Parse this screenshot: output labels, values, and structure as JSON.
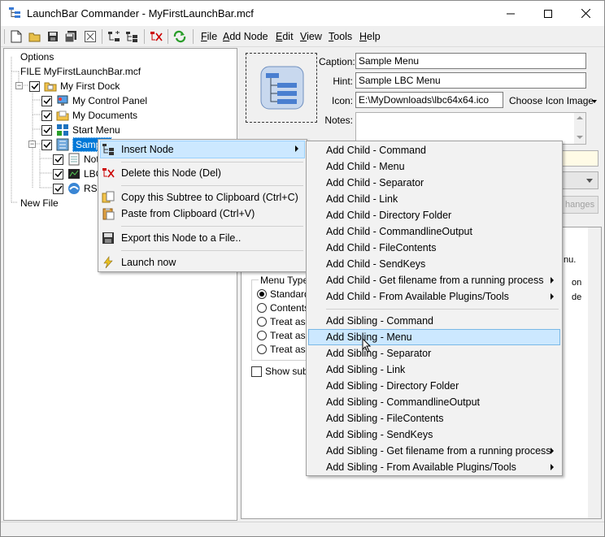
{
  "window": {
    "title": "LaunchBar Commander - MyFirstLaunchBar.mcf",
    "minimize_glyph": "—",
    "maximize_glyph": "☐",
    "close_glyph": "✕"
  },
  "menubar": {
    "items": [
      {
        "label": "File",
        "underline": "F",
        "rest": "ile"
      },
      {
        "label": "Add Node",
        "underline": "A",
        "rest": "dd Node"
      },
      {
        "label": "Edit",
        "underline": "E",
        "rest": "dit"
      },
      {
        "label": "View",
        "underline": "V",
        "rest": "iew"
      },
      {
        "label": "Tools",
        "underline": "T",
        "rest": "ools"
      },
      {
        "label": "Help",
        "underline": "H",
        "rest": "elp"
      }
    ]
  },
  "tree": {
    "options": "Options",
    "file": "FILE MyFirstLaunchBar.mcf",
    "dock": "My First Dock",
    "control_panel": "My Control Panel",
    "documents": "My Documents",
    "start_menu": "Start Menu",
    "sample_menu": "Sample",
    "child1": "Not",
    "child2": "LBC",
    "child3": "RS",
    "new_file": "New File"
  },
  "properties": {
    "caption_label": "Caption:",
    "caption_value": "Sample Menu",
    "hint_label": "Hint:",
    "hint_value": "Sample LBC Menu",
    "icon_label": "Icon:",
    "icon_value": "E:\\MyDownloads\\lbc64x64.ico",
    "choose_icon": "Choose Icon Image",
    "notes_label": "Notes:",
    "apply_partial": "hanges",
    "partial_nu": "nu.",
    "partial_on": "on",
    "partial_de": "de"
  },
  "menu_type": {
    "legend": "Menu Type",
    "options": [
      "Standard",
      "Contents",
      "Treat as t",
      "Treat as b",
      "Treat as a"
    ],
    "show_submenu": "Show subm"
  },
  "context_menu": {
    "insert_node": "Insert Node",
    "delete_node": "Delete this Node (Del)",
    "copy_subtree": "Copy this Subtree to Clipboard (Ctrl+C)",
    "paste": "Paste from Clipboard (Ctrl+V)",
    "export": "Export this Node to a File..",
    "launch": "Launch now"
  },
  "submenu": {
    "children": [
      "Add Child - Command",
      "Add Child - Menu",
      "Add Child - Separator",
      "Add Child - Link",
      "Add Child - Directory Folder",
      "Add Child - CommandlineOutput",
      "Add Child - FileContents",
      "Add Child - SendKeys",
      "Add Child - Get filename from a running process",
      "Add Child - From Available Plugins/Tools"
    ],
    "siblings": [
      "Add Sibling - Command",
      "Add Sibling - Menu",
      "Add Sibling - Separator",
      "Add Sibling - Link",
      "Add Sibling - Directory Folder",
      "Add Sibling - CommandlineOutput",
      "Add Sibling - FileContents",
      "Add Sibling - SendKeys",
      "Add Sibling - Get filename from a running process",
      "Add Sibling - From Available Plugins/Tools"
    ]
  },
  "colors": {
    "highlight": "#cce8ff",
    "highlight_border": "#99d1ff",
    "selection": "#0078d7",
    "note_yellow": "#fffbe6"
  }
}
